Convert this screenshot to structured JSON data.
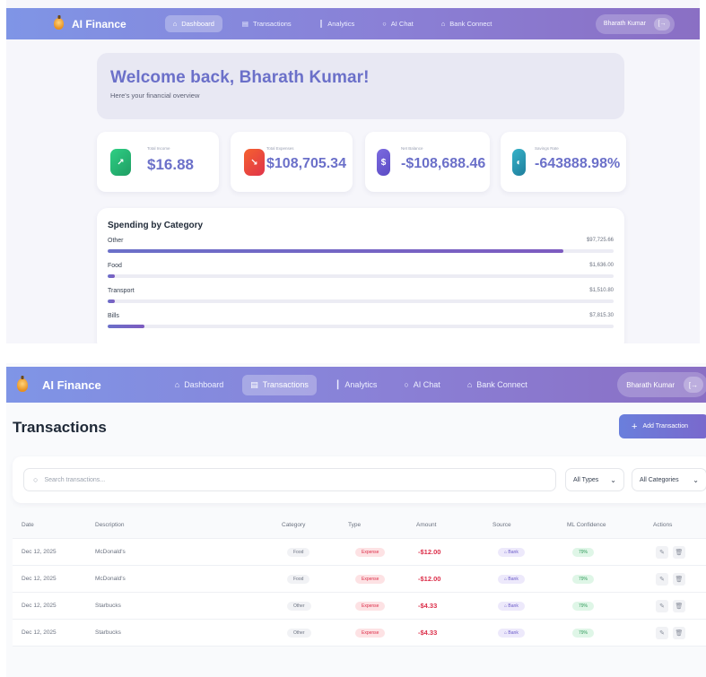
{
  "dashboard_view": {
    "nav": {
      "brand": "AI Finance",
      "items": [
        {
          "label": "Dashboard",
          "icon": "home-icon",
          "active": true
        },
        {
          "label": "Transactions",
          "icon": "list-icon",
          "active": false
        },
        {
          "label": "Analytics",
          "icon": "chart-icon",
          "active": false
        },
        {
          "label": "AI Chat",
          "icon": "chat-icon",
          "active": false
        },
        {
          "label": "Bank Connect",
          "icon": "bank-icon",
          "active": false
        }
      ],
      "user": "Bharath Kumar",
      "logout_icon": "[→"
    },
    "welcome": {
      "title": "Welcome back, Bharath Kumar!",
      "subtitle": "Here's your financial overview"
    },
    "stats": [
      {
        "label": "Total Income",
        "value": "$16.88",
        "icon": "trend-up-icon",
        "color": "#22b06d"
      },
      {
        "label": "Total Expenses",
        "value": "$108,705.34",
        "icon": "trend-down-icon",
        "color": "#ef4a3a"
      },
      {
        "label": "Net Balance",
        "value": "-$108,688.46",
        "icon": "dollar-icon",
        "color": "#6b5bc9"
      },
      {
        "label": "Savings Rate",
        "value": "-643888.98%",
        "icon": "piggy-bank-icon",
        "color": "#2c9fb8"
      }
    ],
    "spending": {
      "title": "Spending by Category",
      "categories": [
        {
          "name": "Other",
          "amount": "$97,725.66",
          "share": 0.9
        },
        {
          "name": "Food",
          "amount": "$1,636.00",
          "share": 0.015
        },
        {
          "name": "Transport",
          "amount": "$1,510.80",
          "share": 0.014
        },
        {
          "name": "Bills",
          "amount": "$7,815.30",
          "share": 0.072
        }
      ]
    }
  },
  "transactions_view": {
    "nav": {
      "brand": "AI Finance",
      "items": [
        {
          "label": "Dashboard",
          "icon": "home-icon",
          "active": false
        },
        {
          "label": "Transactions",
          "icon": "list-icon",
          "active": true
        },
        {
          "label": "Analytics",
          "icon": "chart-icon",
          "active": false
        },
        {
          "label": "AI Chat",
          "icon": "chat-icon",
          "active": false
        },
        {
          "label": "Bank Connect",
          "icon": "bank-icon",
          "active": false
        }
      ],
      "user": "Bharath Kumar",
      "logout_icon": "[→"
    },
    "title": "Transactions",
    "add_button": "Add Transaction",
    "search_placeholder": "Search transactions...",
    "type_filter": "All Types",
    "category_filter": "All Categories",
    "columns": [
      "Date",
      "Description",
      "Category",
      "Type",
      "Amount",
      "Source",
      "ML Confidence",
      "Actions"
    ],
    "rows": [
      {
        "date": "Dec 12, 2025",
        "description": "McDonald's",
        "category": "Food",
        "type": "Expense",
        "amount": "-$12.00",
        "source": "Bank",
        "confidence": "79%"
      },
      {
        "date": "Dec 12, 2025",
        "description": "McDonald's",
        "category": "Food",
        "type": "Expense",
        "amount": "-$12.00",
        "source": "Bank",
        "confidence": "79%"
      },
      {
        "date": "Dec 12, 2025",
        "description": "Starbucks",
        "category": "Other",
        "type": "Expense",
        "amount": "-$4.33",
        "source": "Bank",
        "confidence": "79%"
      },
      {
        "date": "Dec 12, 2025",
        "description": "Starbucks",
        "category": "Other",
        "type": "Expense",
        "amount": "-$4.33",
        "source": "Bank",
        "confidence": "79%"
      }
    ]
  }
}
